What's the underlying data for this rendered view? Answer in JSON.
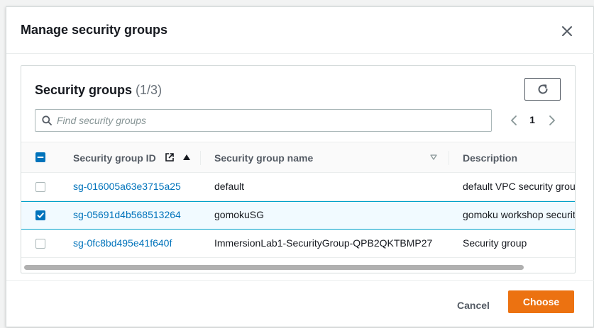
{
  "modal": {
    "title": "Manage security groups",
    "close_icon": "close-icon"
  },
  "panel": {
    "title": "Security groups",
    "count": "(1/3)",
    "refresh_icon": "refresh-icon"
  },
  "search": {
    "placeholder": "Find security groups",
    "value": "",
    "icon": "search-icon"
  },
  "pagination": {
    "current_page": "1",
    "prev_icon": "chevron-left-icon",
    "next_icon": "chevron-right-icon"
  },
  "table": {
    "columns": {
      "id": "Security group ID",
      "name": "Security group name",
      "description": "Description"
    },
    "rows": [
      {
        "id": "sg-016005a63e3715a25",
        "name": "default",
        "description": "default VPC security group",
        "selected": false
      },
      {
        "id": "sg-05691d4b568513264",
        "name": "gomokuSG",
        "description": "gomoku workshop security group",
        "selected": true
      },
      {
        "id": "sg-0fc8bd495e41f640f",
        "name": "ImmersionLab1-SecurityGroup-QPB2QKTBMP27",
        "description": "Security group",
        "selected": false
      }
    ]
  },
  "footer": {
    "cancel_label": "Cancel",
    "choose_label": "Choose"
  },
  "colors": {
    "primary_button": "#ec7211",
    "link": "#0073bb",
    "checkbox_checked": "#0073bb",
    "selected_row_bg": "#f1faff"
  }
}
